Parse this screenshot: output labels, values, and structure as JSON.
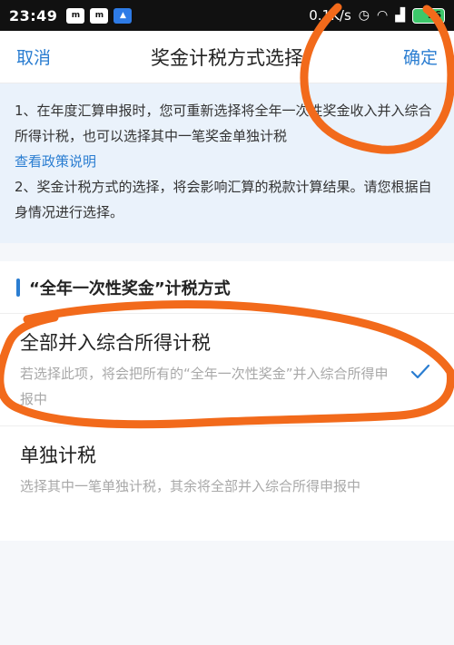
{
  "status_bar": {
    "time": "23:49",
    "apps": [
      "m",
      "m"
    ],
    "network_speed": "0.1K/s",
    "battery": "96"
  },
  "header": {
    "cancel_label": "取消",
    "title": "奖金计税方式选择",
    "confirm_label": "确定"
  },
  "notice": {
    "line1": "1、在年度汇算申报时，您可重新选择将全年一次性奖金收入并入综合所得计税，也可以选择其中一笔奖金单独计税",
    "link": "查看政策说明",
    "line2": "2、奖金计税方式的选择，将会影响汇算的税款计算结果。请您根据自身情况进行选择。"
  },
  "section": {
    "title": "“全年一次性奖金”计税方式"
  },
  "options": [
    {
      "title": "全部并入综合所得计税",
      "description": "若选择此项，将会把所有的“全年一次性奖金”并入综合所得申报中",
      "selected": true
    },
    {
      "title": "单独计税",
      "description": "选择其中一笔单独计税，其余将全部并入综合所得申报中",
      "selected": false
    }
  ],
  "colors": {
    "accent": "#2a7dd1",
    "annotation": "#f26a1b",
    "notice_bg": "#eaf2fb"
  }
}
